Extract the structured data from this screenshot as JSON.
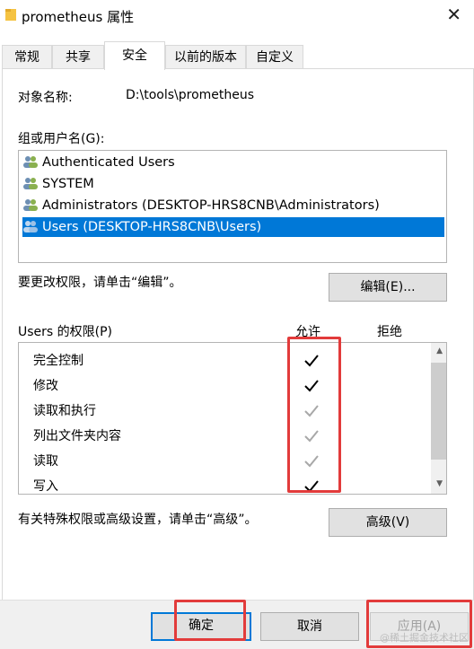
{
  "window": {
    "title": "prometheus 属性",
    "close_symbol": "✕"
  },
  "tabs": [
    {
      "label": "常规"
    },
    {
      "label": "共享"
    },
    {
      "label": "安全"
    },
    {
      "label": "以前的版本"
    },
    {
      "label": "自定义"
    }
  ],
  "object": {
    "label": "对象名称:",
    "value": "D:\\tools\\prometheus"
  },
  "groups": {
    "label": "组或用户名(G):",
    "items": [
      {
        "label": "Authenticated Users",
        "selected": false
      },
      {
        "label": "SYSTEM",
        "selected": false
      },
      {
        "label": "Administrators (DESKTOP-HRS8CNB\\Administrators)",
        "selected": false
      },
      {
        "label": "Users (DESKTOP-HRS8CNB\\Users)",
        "selected": true
      }
    ]
  },
  "edit": {
    "hint": "要更改权限，请单击“编辑”。",
    "button": "编辑(E)..."
  },
  "permissions": {
    "label": "Users 的权限(P)",
    "allow_header": "允许",
    "deny_header": "拒绝",
    "rows": [
      {
        "name": "完全控制",
        "allow": "black"
      },
      {
        "name": "修改",
        "allow": "black"
      },
      {
        "name": "读取和执行",
        "allow": "gray"
      },
      {
        "name": "列出文件夹内容",
        "allow": "gray"
      },
      {
        "name": "读取",
        "allow": "gray"
      },
      {
        "name": "写入",
        "allow": "black"
      }
    ]
  },
  "advanced": {
    "hint": "有关特殊权限或高级设置，请单击“高级”。",
    "button": "高级(V)"
  },
  "footer": {
    "ok": "确定",
    "cancel": "取消",
    "apply": "应用(A)"
  },
  "watermark": "@稀土掘金技术社区",
  "colors": {
    "selection": "#0078d7",
    "highlight_box": "#e23b3b"
  }
}
